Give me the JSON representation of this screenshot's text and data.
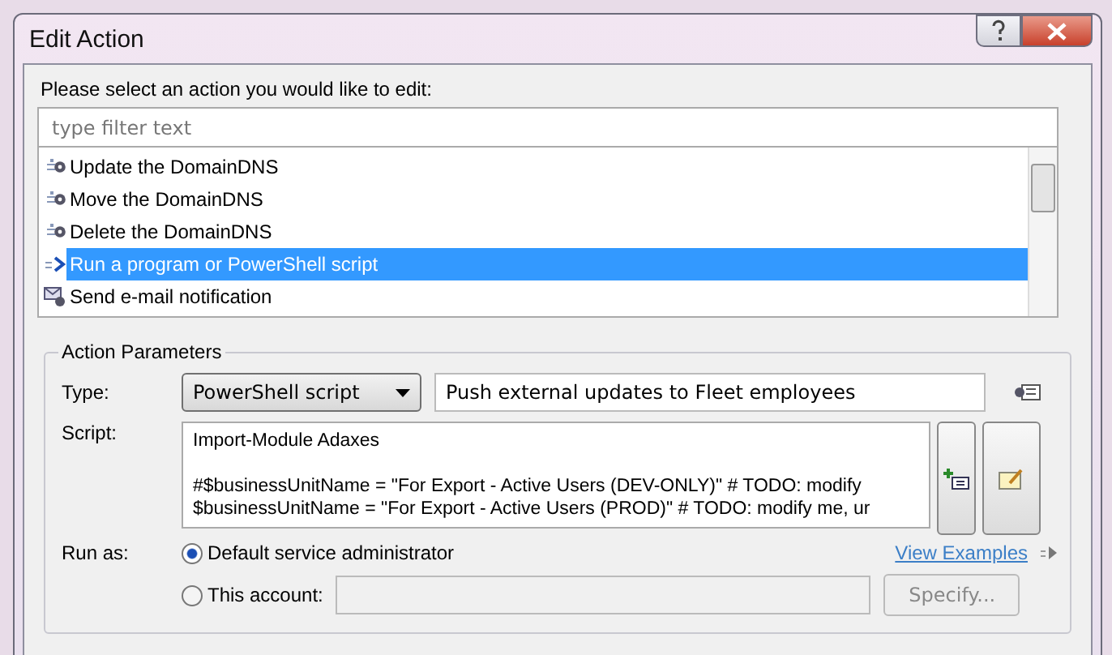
{
  "window": {
    "title": "Edit Action"
  },
  "prompt": "Please select an action you would like to edit:",
  "filter": {
    "placeholder": "type filter text"
  },
  "actions": [
    {
      "label": "Update the DomainDNS",
      "kind": "gear",
      "selected": false
    },
    {
      "label": "Move the DomainDNS",
      "kind": "gear",
      "selected": false
    },
    {
      "label": "Delete the DomainDNS",
      "kind": "gear",
      "selected": false
    },
    {
      "label": "Run a program or PowerShell script",
      "kind": "script",
      "selected": true
    },
    {
      "label": "Send e-mail notification",
      "kind": "mail",
      "selected": false
    }
  ],
  "parameters": {
    "title": "Action Parameters",
    "type_label": "Type:",
    "type_value": "PowerShell script",
    "description": "Push external updates to Fleet employees",
    "script_label": "Script:",
    "script_lines": [
      "Import-Module Adaxes",
      "#$businessUnitName = \"For Export - Active Users (DEV-ONLY)\" # TODO: modify",
      "$businessUnitName = \"For Export - Active Users (PROD)\" # TODO: modify me, ur"
    ],
    "run_as_label": "Run as:",
    "view_examples": "View Examples",
    "run_as_options": [
      {
        "label": "Default service administrator",
        "selected": true
      },
      {
        "label": "This account:",
        "selected": false
      }
    ],
    "specify": "Specify..."
  }
}
